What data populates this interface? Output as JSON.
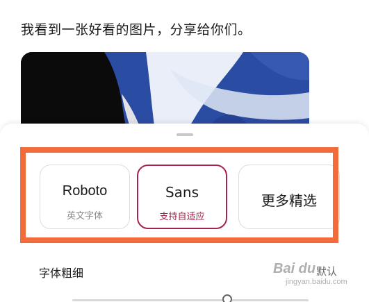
{
  "message": {
    "text": "我看到一张好看的图片，分享给你们。"
  },
  "image": {
    "icon": "shared-abstract-blue-image"
  },
  "font_sheet": {
    "options": [
      {
        "name": "Roboto",
        "subtitle": "英文字体",
        "selected": false
      },
      {
        "name": "Sans",
        "subtitle": "支持自适应",
        "selected": true
      },
      {
        "name": "更多精选",
        "subtitle": "",
        "selected": false
      }
    ],
    "weight_label": "字体粗细",
    "weight_default": "默认",
    "weight_level": 0.7
  },
  "colors": {
    "accent": "#a3244a",
    "highlight": "#f26b3a",
    "image_blue": "#2a4aa0"
  },
  "watermark": {
    "logo": "Bai du",
    "url": "jingyan.baidu.com"
  }
}
